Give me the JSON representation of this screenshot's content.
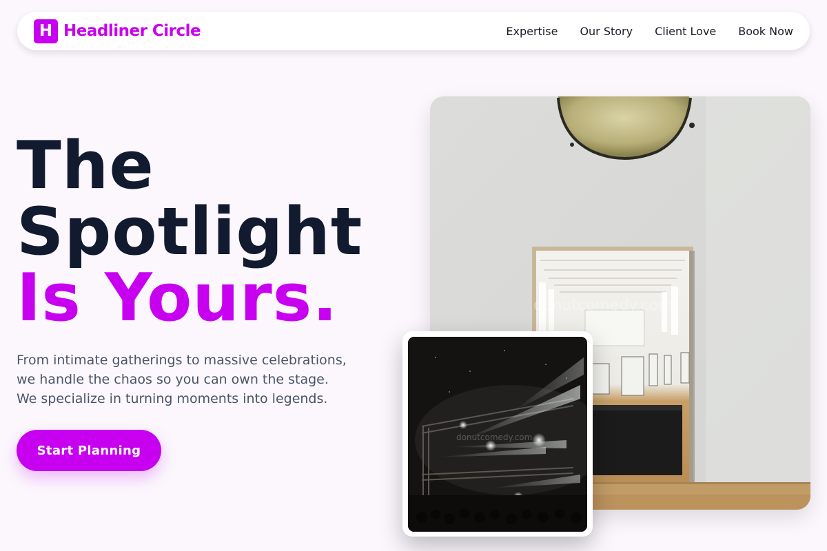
{
  "brand": {
    "mark": "H",
    "name": "Headliner Circle",
    "color": "#c800f0"
  },
  "nav": {
    "links": [
      {
        "label": "Expertise"
      },
      {
        "label": "Our Story"
      },
      {
        "label": "Client Love"
      },
      {
        "label": "Book Now"
      }
    ]
  },
  "hero": {
    "headline_line1": "The",
    "headline_line2": "Spotlight",
    "headline_line3": "Is Yours.",
    "subcopy_line1": "From intimate gatherings to massive celebrations,",
    "subcopy_line2": "we handle the chaos so you can own the stage.",
    "subcopy_line3": "We specialize in turning moments into legends.",
    "cta_label": "Start Planning"
  },
  "images": {
    "main_watermark": "donutcomedy.com",
    "inset_watermark": "donutcomedy.com"
  },
  "colors": {
    "accent": "#c800f0",
    "heading": "#111a2e",
    "body_text": "#4a5568",
    "background": "#fbf7fd"
  }
}
